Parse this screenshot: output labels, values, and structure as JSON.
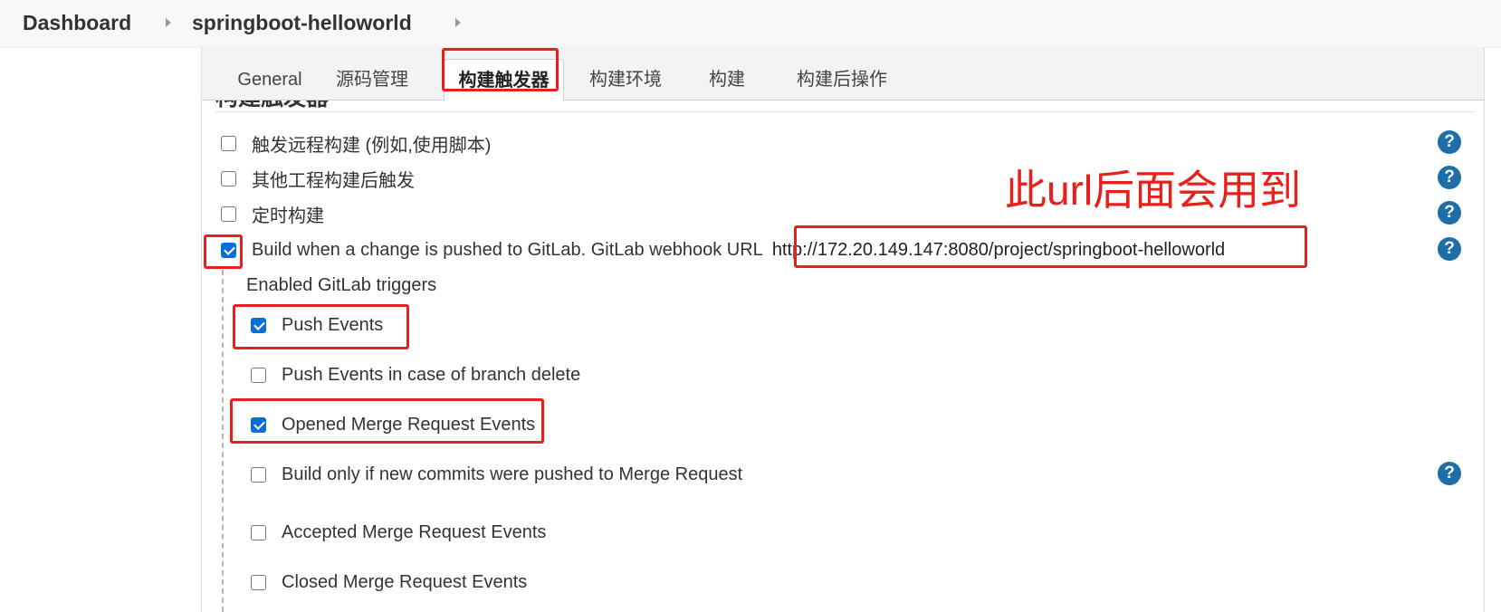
{
  "breadcrumb": {
    "items": [
      "Dashboard",
      "springboot-helloworld"
    ]
  },
  "tabs": [
    {
      "label": "General",
      "active": false
    },
    {
      "label": "源码管理",
      "active": false
    },
    {
      "label": "构建触发器",
      "active": true
    },
    {
      "label": "构建环境",
      "active": false
    },
    {
      "label": "构建",
      "active": false
    },
    {
      "label": "构建后操作",
      "active": false
    }
  ],
  "section": {
    "title": "构建触发器"
  },
  "triggers": [
    {
      "label": "触发远程构建 (例如,使用脚本)",
      "checked": false
    },
    {
      "label": "其他工程构建后触发",
      "checked": false
    },
    {
      "label": "定时构建",
      "checked": false
    },
    {
      "label": "Build when a change is pushed to GitLab. GitLab webhook URL",
      "checked": true,
      "url": "http://172.20.149.147:8080/project/springboot-helloworld"
    }
  ],
  "gitlab": {
    "heading": "Enabled GitLab triggers",
    "options": [
      {
        "label": "Push Events",
        "checked": true
      },
      {
        "label": "Push Events in case of branch delete",
        "checked": false
      },
      {
        "label": "Opened Merge Request Events",
        "checked": true
      },
      {
        "label": "Build only if new commits were pushed to Merge Request",
        "checked": false
      },
      {
        "label": "Accepted Merge Request Events",
        "checked": false
      },
      {
        "label": "Closed Merge Request Events",
        "checked": false
      }
    ]
  },
  "help_glyph": "?",
  "annotation": {
    "note": "此url后面会用到",
    "color": "#e8201b"
  },
  "colors": {
    "checkbox_checked": "#0b6ed6",
    "help_icon": "#1e6fa8"
  }
}
